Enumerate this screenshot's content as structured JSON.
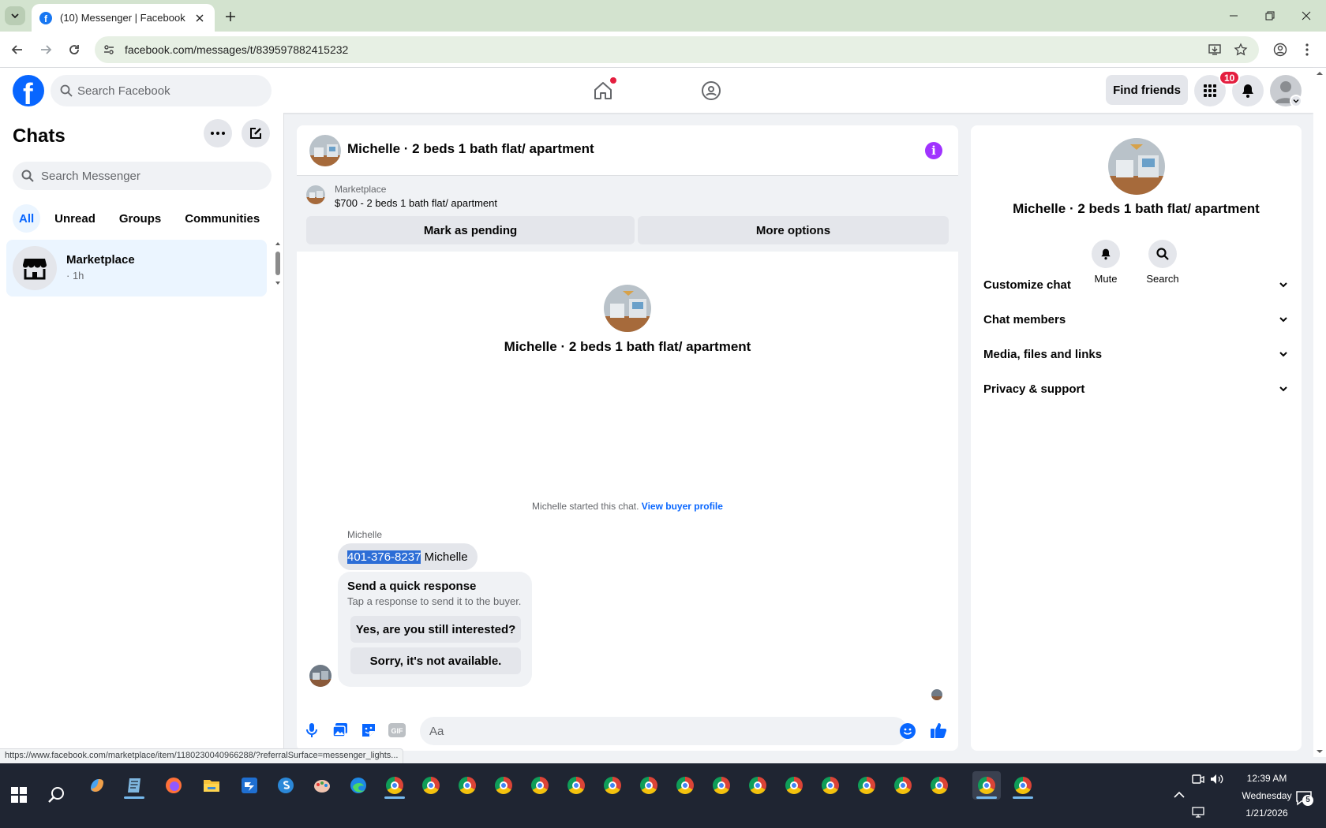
{
  "browser": {
    "tab_title": "(10) Messenger | Facebook",
    "url": "facebook.com/messages/t/8395978824152​32",
    "status_url": "https://www.facebook.com/marketplace/item/1180230040966288/?referralSurface=messenger_lights..."
  },
  "fb_header": {
    "search_placeholder": "Search Facebook",
    "find_friends": "Find friends",
    "notification_count": "10"
  },
  "sidebar": {
    "title": "Chats",
    "search_placeholder": "Search Messenger",
    "filters": [
      "All",
      "Unread",
      "Groups",
      "Communities"
    ],
    "chats": [
      {
        "name": "Marketplace",
        "time": "· 1h"
      }
    ]
  },
  "conversation": {
    "title": "Michelle · 2 beds 1 bath flat/ apartment",
    "marketplace_label": "Marketplace",
    "listing": "$700 - 2 beds 1 bath flat/ apartment",
    "mark_pending": "Mark as pending",
    "more_options": "More options",
    "center_name": "Michelle · 2 beds 1 bath flat/ apartment",
    "started_text": "Michelle started this chat.",
    "view_buyer_profile": "View buyer profile",
    "sender_name": "Michelle",
    "message_phone": "401-376-8237",
    "message_rest": " Michelle",
    "quick_title": "Send a quick response",
    "quick_sub": "Tap a response to send it to the buyer.",
    "quick_replies": [
      "Yes, are you still interested?",
      "Sorry, it's not available."
    ],
    "composer_placeholder": "Aa"
  },
  "info_panel": {
    "name": "Michelle · 2 beds 1 bath flat/ apartment",
    "actions": [
      "Mute",
      "Search"
    ],
    "sections": [
      "Customize chat",
      "Chat members",
      "Media, files and links",
      "Privacy & support"
    ]
  },
  "taskbar": {
    "time": "12:39 AM",
    "day": "Wednesday",
    "date": "1/21/2026",
    "notif_count": "5"
  },
  "colors": {
    "fb_blue": "#0866ff",
    "info_purple": "#a033ff",
    "badge_red": "#e41e3f",
    "taskbar": "#1f2532"
  }
}
